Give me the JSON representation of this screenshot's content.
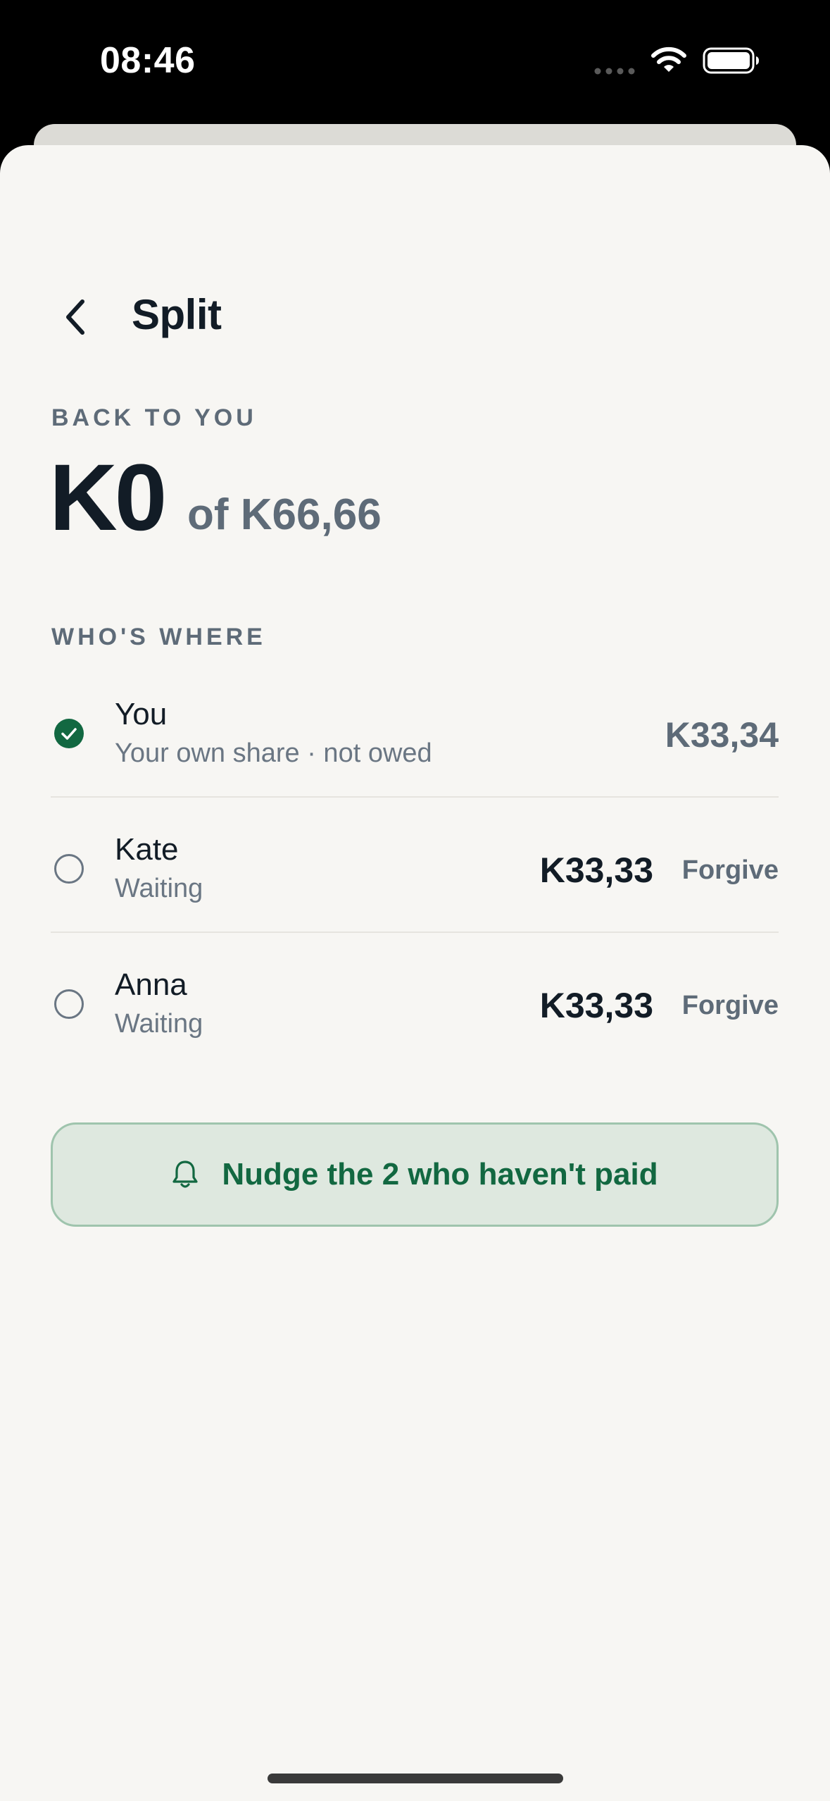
{
  "status_bar": {
    "time": "08:46",
    "icons": [
      "cellular-dots-icon",
      "wifi-icon",
      "battery-icon"
    ]
  },
  "header": {
    "back_icon": "chevron-left-icon",
    "title": "Split"
  },
  "summary": {
    "label": "BACK TO YOU",
    "amount": "K0",
    "of_total": "of K66,66"
  },
  "participants_section": {
    "label": "WHO'S WHERE",
    "rows": [
      {
        "name": "You",
        "subtitle": "Your own share · not owed",
        "amount": "K33,34",
        "status": "paid",
        "status_icon": "check-circle-icon"
      },
      {
        "name": "Kate",
        "subtitle": "Waiting",
        "amount": "K33,33",
        "status": "waiting",
        "status_icon": "empty-circle-icon",
        "action_label": "Forgive"
      },
      {
        "name": "Anna",
        "subtitle": "Waiting",
        "amount": "K33,33",
        "status": "waiting",
        "status_icon": "empty-circle-icon",
        "action_label": "Forgive"
      }
    ]
  },
  "nudge": {
    "icon": "bell-icon",
    "label": "Nudge the 2 who haven't paid"
  },
  "colors": {
    "background": "#f7f6f3",
    "text_primary": "#121c26",
    "text_secondary": "#5e6b78",
    "accent_green": "#126841",
    "nudge_fill": "#dee8df",
    "nudge_border": "#9fc4ad"
  }
}
